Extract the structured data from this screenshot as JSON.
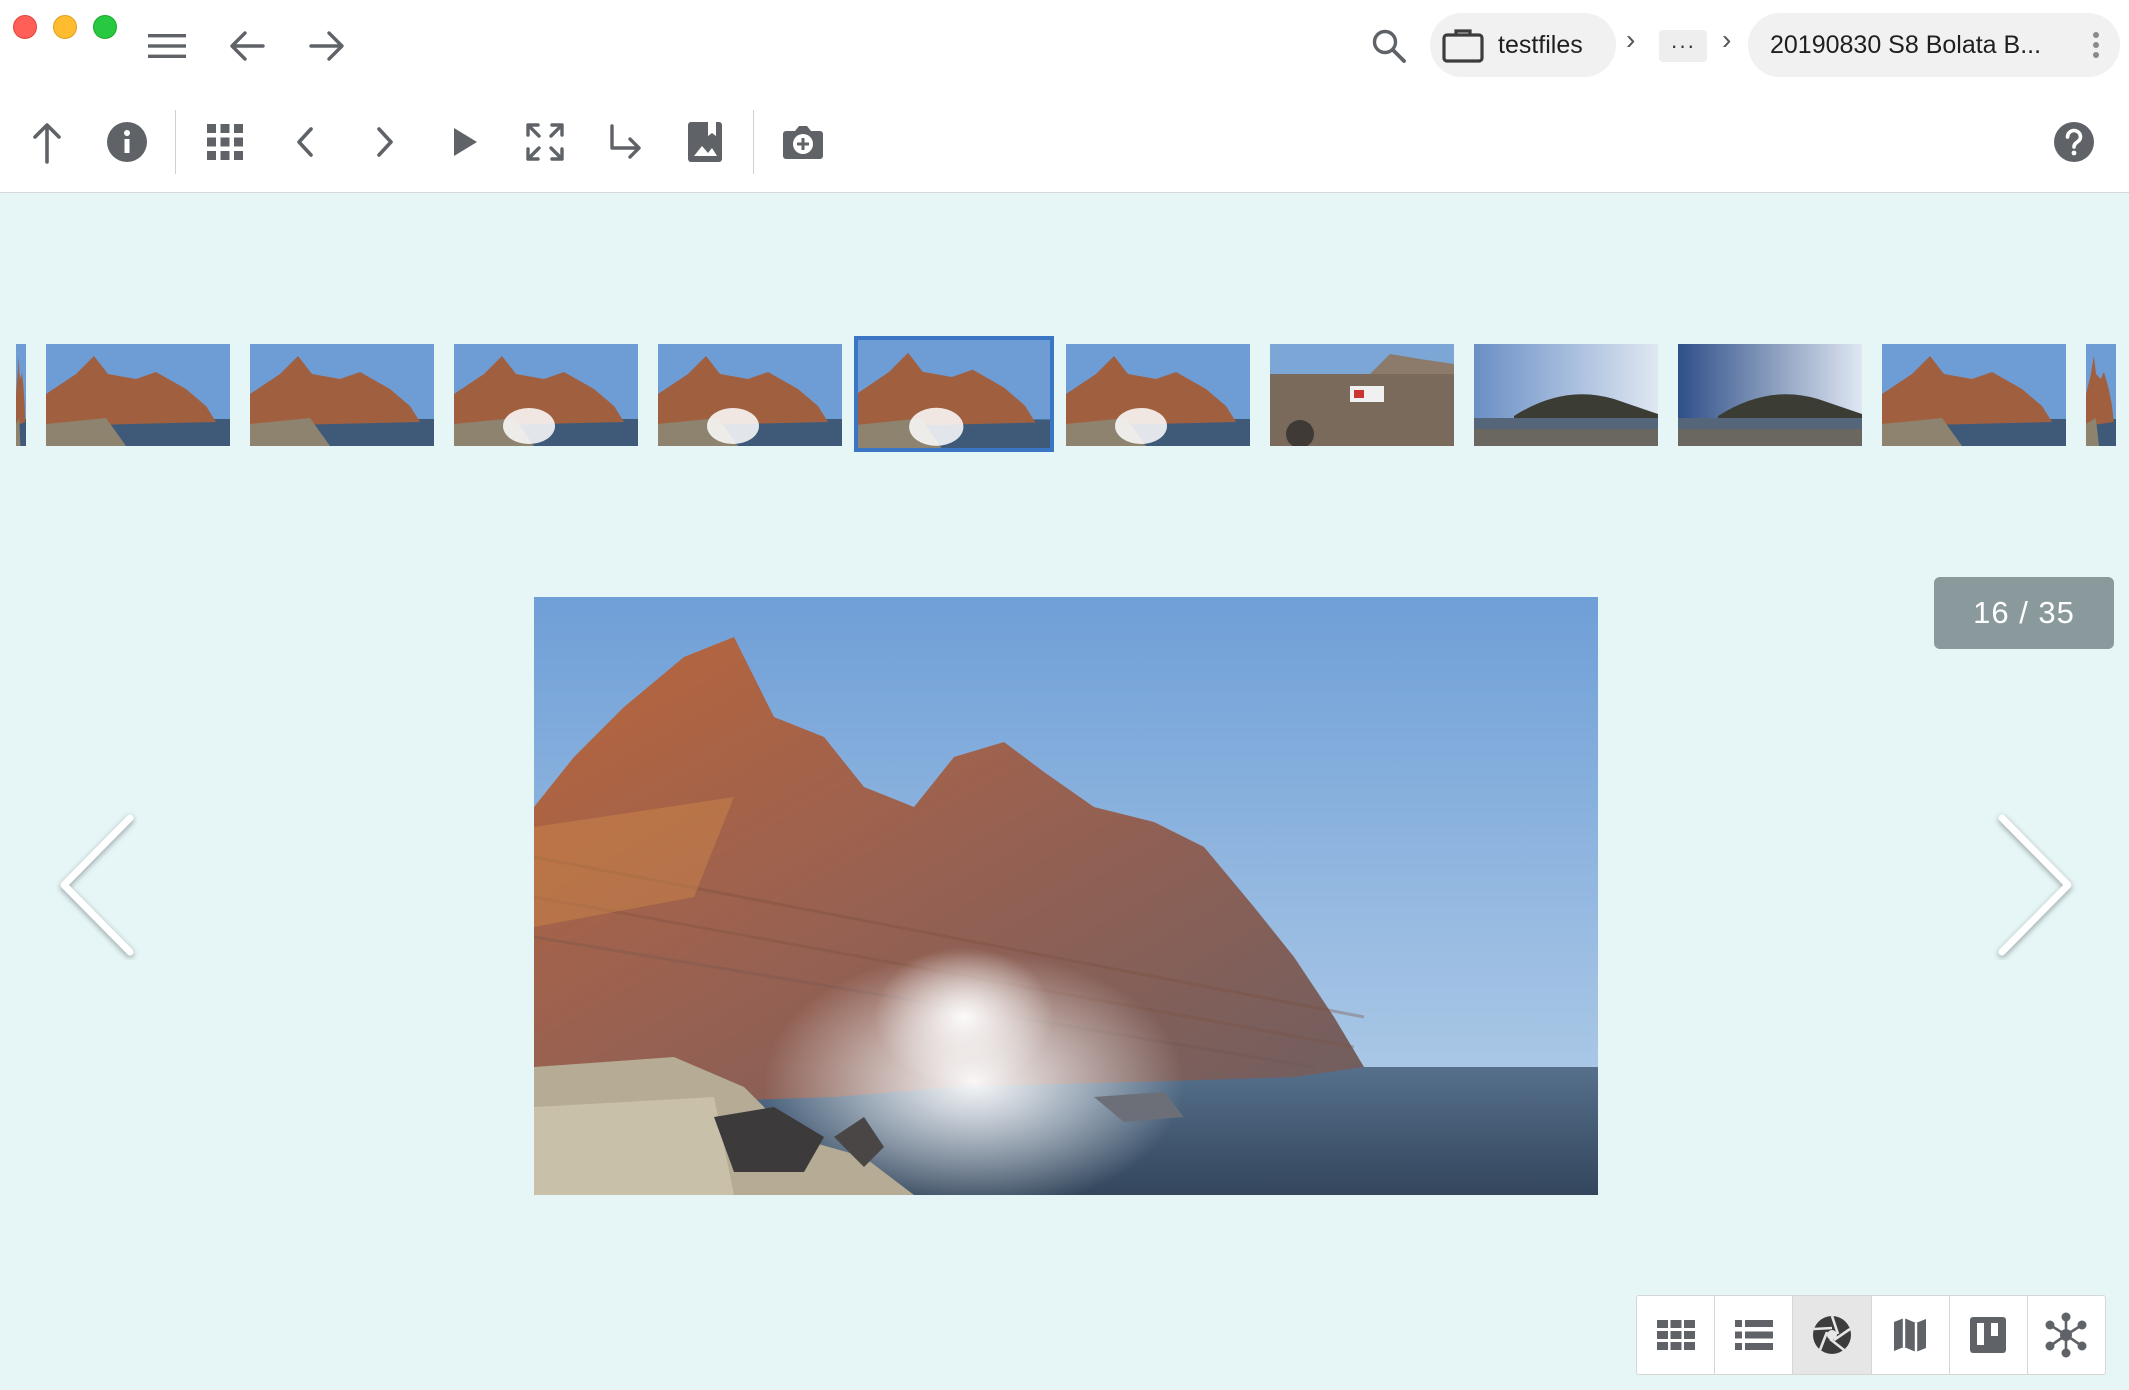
{
  "window": {
    "controls": [
      "close",
      "minimize",
      "zoom"
    ]
  },
  "titlebar": {
    "menu_icon": "hamburger-menu-icon",
    "back_icon": "arrow-left-icon",
    "forward_icon": "arrow-right-icon",
    "search_icon": "search-icon",
    "breadcrumb": {
      "root_label": "testfiles",
      "root_icon": "briefcase-icon",
      "separator": "›",
      "ellipsis": "···",
      "current_label": "20190830 S8 Bolata B...",
      "more_icon": "vertical-dots-icon"
    }
  },
  "toolbar": {
    "tools": [
      {
        "name": "up-folder",
        "icon": "arrow-up-icon"
      },
      {
        "name": "info",
        "icon": "info-icon"
      },
      {
        "name": "thumbnails",
        "icon": "grid-icon"
      },
      {
        "name": "previous",
        "icon": "chevron-left-icon"
      },
      {
        "name": "next",
        "icon": "chevron-right-icon"
      },
      {
        "name": "slideshow",
        "icon": "play-icon"
      },
      {
        "name": "fullscreen",
        "icon": "fullscreen-icon"
      },
      {
        "name": "goto",
        "icon": "subdirectory-arrow-icon"
      },
      {
        "name": "bookmark",
        "icon": "photo-bookmark-icon"
      },
      {
        "name": "add-photo",
        "icon": "camera-plus-icon"
      }
    ],
    "help_icon": "help-icon"
  },
  "filmstrip": {
    "thumbnail_count_visible": 11,
    "selected_index": 5
  },
  "viewer": {
    "counter": "16 / 35",
    "prev_icon": "large-chevron-left-icon",
    "next_icon": "large-chevron-right-icon"
  },
  "viewbar": {
    "active_index": 2,
    "views": [
      {
        "name": "grid",
        "icon": "grid-view-icon"
      },
      {
        "name": "list",
        "icon": "list-view-icon"
      },
      {
        "name": "gallery",
        "icon": "aperture-icon"
      },
      {
        "name": "map",
        "icon": "map-icon"
      },
      {
        "name": "board",
        "icon": "kanban-icon"
      },
      {
        "name": "graph",
        "icon": "graph-icon"
      }
    ]
  },
  "colors": {
    "background": "#e6f5f6",
    "selection": "#3a76c4",
    "counter_bg": "#8a9a9c",
    "icon": "#5f6368"
  }
}
